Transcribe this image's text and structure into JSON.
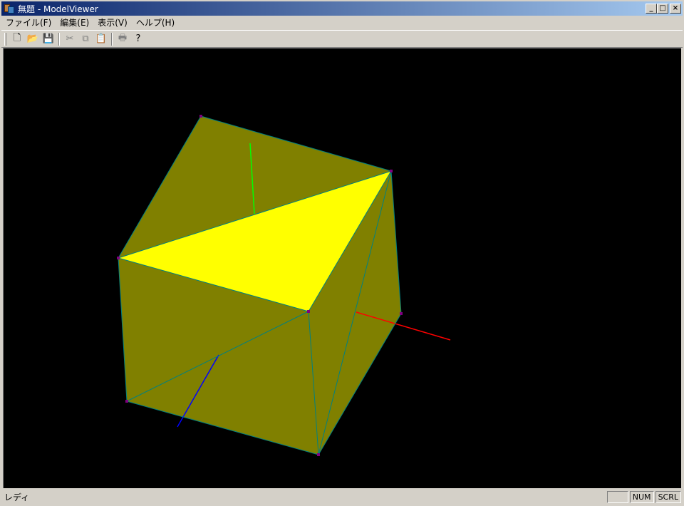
{
  "window": {
    "title": "無題 - ModelViewer"
  },
  "title_buttons": {
    "minimize": "_",
    "maximize": "□",
    "close": "×"
  },
  "menu": [
    "ファイル(F)",
    "編集(E)",
    "表示(V)",
    "ヘルプ(H)"
  ],
  "toolbar": {
    "icons": [
      "new-file-icon",
      "open-folder-icon",
      "save-icon",
      "cut-icon",
      "copy-icon",
      "paste-icon",
      "print-icon",
      "help-icon"
    ],
    "glyphs": {
      "new": "🗋",
      "open": "📂",
      "save": "💾",
      "cut": "✂",
      "copy": "⧉",
      "paste": "📋",
      "print": "🖶",
      "help": "?"
    }
  },
  "status": {
    "text": "レディ",
    "panels": [
      "",
      "NUM",
      "SCRL"
    ]
  },
  "colors": {
    "face_dark": "#808000",
    "face_lit": "#ffff00",
    "edge": "#008080",
    "vertex": "#800080",
    "axis_x": "#ff0000",
    "axis_y": "#00ff00",
    "axis_z": "#0000ff"
  }
}
